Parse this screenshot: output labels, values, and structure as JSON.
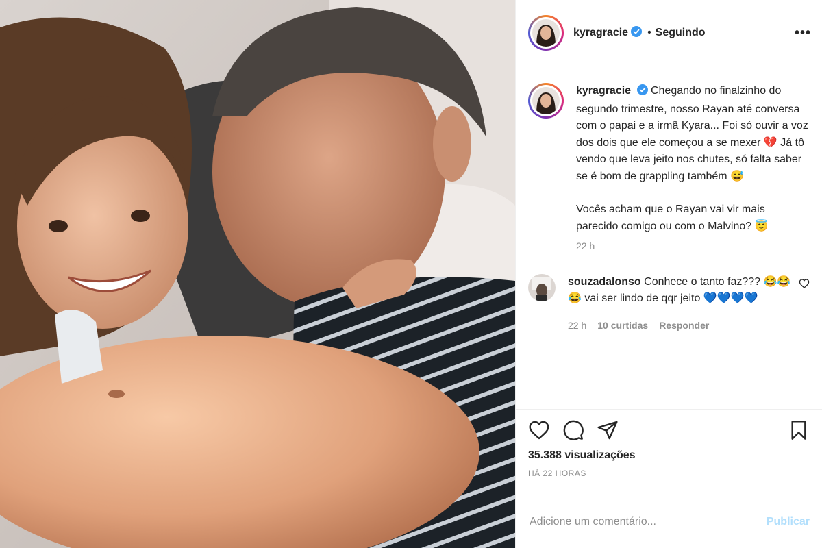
{
  "header": {
    "username": "kyragracie",
    "separator": "•",
    "follow_status": "Seguindo",
    "more_label": "•••"
  },
  "caption": {
    "username": "kyragracie",
    "text_p1": "Chegando no finalzinho do segundo trimestre, nosso Rayan até conversa com o papai e a irmã Kyara... Foi só ouvir a voz dos dois que ele começou a se mexer 💔 Já tô vendo que leva jeito nos chutes, só falta saber se é bom de grappling também 😅",
    "text_p2": "Vocês acham que o Rayan vai vir mais parecido comigo ou com o Malvino? 😇",
    "time": "22 h"
  },
  "comment": {
    "username": "souzadalonso",
    "text": "Conhece o tanto faz??? 😂😂😂 vai ser lindo de qqr jeito 💙💙💙💙",
    "time": "22 h",
    "likes": "10 curtidas",
    "reply": "Responder"
  },
  "stats": {
    "views": "35.388 visualizações",
    "posted_ago": "HÁ 22 HORAS"
  },
  "add_comment": {
    "placeholder": "Adicione um comentário...",
    "publish_label": "Publicar"
  },
  "colors": {
    "verified": "#3897f0",
    "publish_disabled": "#b2dffc",
    "muted_text": "#8e8e8e",
    "border": "#efefef"
  },
  "icons": {
    "like": "heart-icon",
    "comment": "comment-bubble-icon",
    "share": "paper-plane-icon",
    "save": "bookmark-icon",
    "verified": "verified-badge-icon",
    "comment_like": "small-heart-icon"
  }
}
